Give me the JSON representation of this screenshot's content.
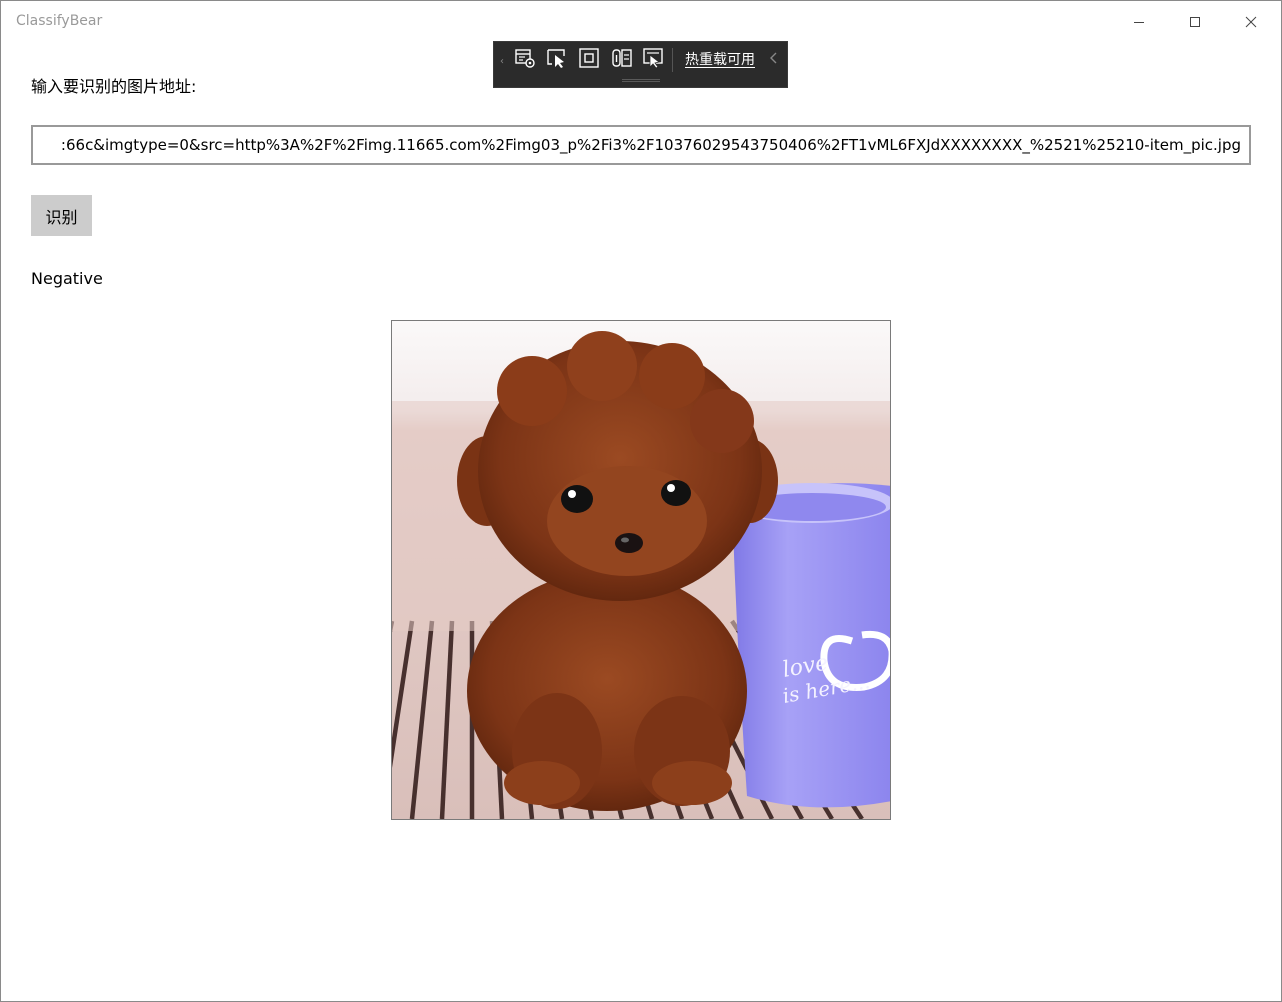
{
  "window": {
    "title": "ClassifyBear"
  },
  "caption_buttons": {
    "minimize_icon": "minimize-icon",
    "maximize_icon": "maximize-icon",
    "close_icon": "close-icon"
  },
  "debug_toolbar": {
    "hot_reload_text": "热重载可用",
    "icons": [
      "live-visual-tree-icon",
      "select-element-icon",
      "display-layout-adorners-icon",
      "track-focus-icon",
      "preview-selection-icon"
    ]
  },
  "main": {
    "prompt_label": "输入要识别的图片地址:",
    "url_value": ":66c&imgtype=0&src=http%3A%2F%2Fimg.11665.com%2Fimg03_p%2Fi3%2F10376029543750406%2FT1vML6FXJdXXXXXXXX_%2521%25210-item_pic.jpg",
    "recognize_button": "识别",
    "result_text": "Negative"
  },
  "image": {
    "subject": "brown toy poodle puppy beside a lavender mug",
    "mug_text_line1": "love",
    "mug_text_line2": "is here...",
    "colors": {
      "fur": "#8a3d1c",
      "mug": "#9c95f0",
      "floor": "#d8c2bd"
    }
  }
}
